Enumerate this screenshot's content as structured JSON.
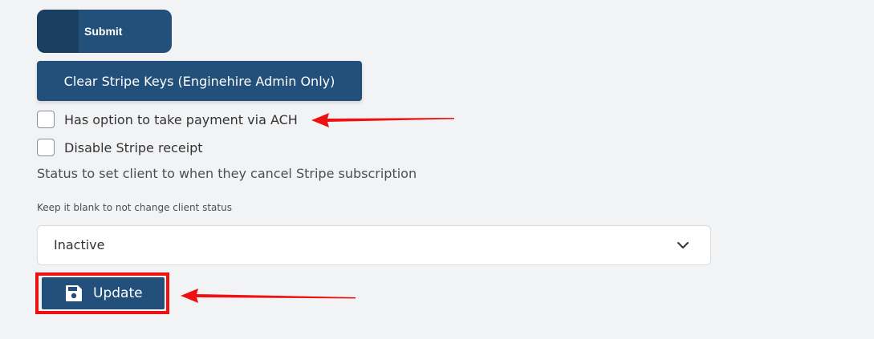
{
  "buttons": {
    "submit_label": "Submit",
    "clear_label": "Clear Stripe Keys (Enginehire Admin Only)",
    "update_label": "Update"
  },
  "checkboxes": [
    {
      "label": "Has option to take payment via ACH",
      "checked": false
    },
    {
      "label": "Disable Stripe receipt",
      "checked": false
    }
  ],
  "status_section": {
    "label": "Status to set client to when they cancel Stripe subscription",
    "hint": "Keep it blank to not change client status",
    "select_value": "Inactive"
  },
  "colors": {
    "primary": "#22507a",
    "primary_dark": "#1b3f61",
    "annotation": "#ee1111",
    "background": "#f2f3f5"
  },
  "icons": [
    "chevron-down-icon",
    "save-icon",
    "annotation-arrow"
  ]
}
